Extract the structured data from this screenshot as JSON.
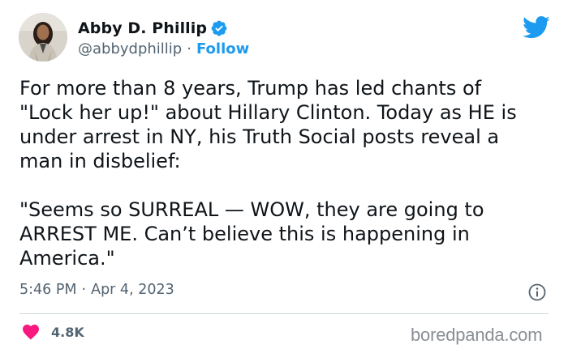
{
  "author": {
    "display_name": "Abby D. Phillip",
    "handle": "@abbydphillip",
    "separator": "·",
    "follow_label": "Follow",
    "verified": true
  },
  "tweet": {
    "text": "For more than 8 years, Trump has led chants of\n\"Lock her up!\" about Hillary Clinton. Today as HE is\nunder arrest in NY, his Truth Social posts reveal a\nman in disbelief:\n\n\"Seems so SURREAL — WOW, they are going to\nARREST ME. Can’t believe this is happening in\nAmerica.\"",
    "time": "5:46 PM",
    "separator": "·",
    "date": "Apr 4, 2023"
  },
  "engagement": {
    "likes": "4.8K"
  },
  "watermark": "boredpanda.com",
  "icons": {
    "verified": "verified-badge-icon",
    "platform": "twitter-bird-icon",
    "info": "info-icon",
    "like": "heart-icon"
  },
  "colors": {
    "accent": "#1d9bf0",
    "heart": "#f91880",
    "secondary_text": "#536471",
    "primary_text": "#0f1419",
    "divider": "#cfd9de"
  }
}
